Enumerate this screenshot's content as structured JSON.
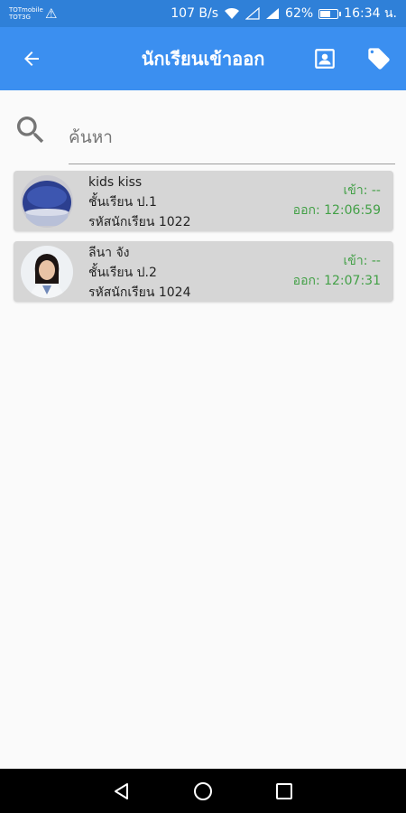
{
  "status_bar": {
    "carrier_line1": "TOTmobile",
    "carrier_line2": "TOT3G",
    "speed": "107 B/s",
    "battery": "62%",
    "battery_level": 0.62,
    "time": "16:34 น."
  },
  "app_bar": {
    "title": "นักเรียนเข้าออก",
    "icons": [
      "arrow-back-icon",
      "contact-icon",
      "tag-icon"
    ]
  },
  "search": {
    "placeholder": "ค้นหา",
    "value": ""
  },
  "students": [
    {
      "name": "kids kiss",
      "class_label": "ชั้นเรียน ป.1",
      "id_label": "รหัสนักเรียน 1022",
      "time_in": "เข้า: --",
      "time_out": "ออก: 12:06:59"
    },
    {
      "name": "ลีนา จัง",
      "class_label": "ชั้นเรียน ป.2",
      "id_label": "รหัสนักเรียน 1024",
      "time_in": "เข้า: --",
      "time_out": "ออก: 12:07:31"
    }
  ],
  "colors": {
    "status_bar": "#2f80d8",
    "app_bar": "#3b8ff0",
    "card": "#d6d6d6",
    "time_text": "#43a047"
  }
}
